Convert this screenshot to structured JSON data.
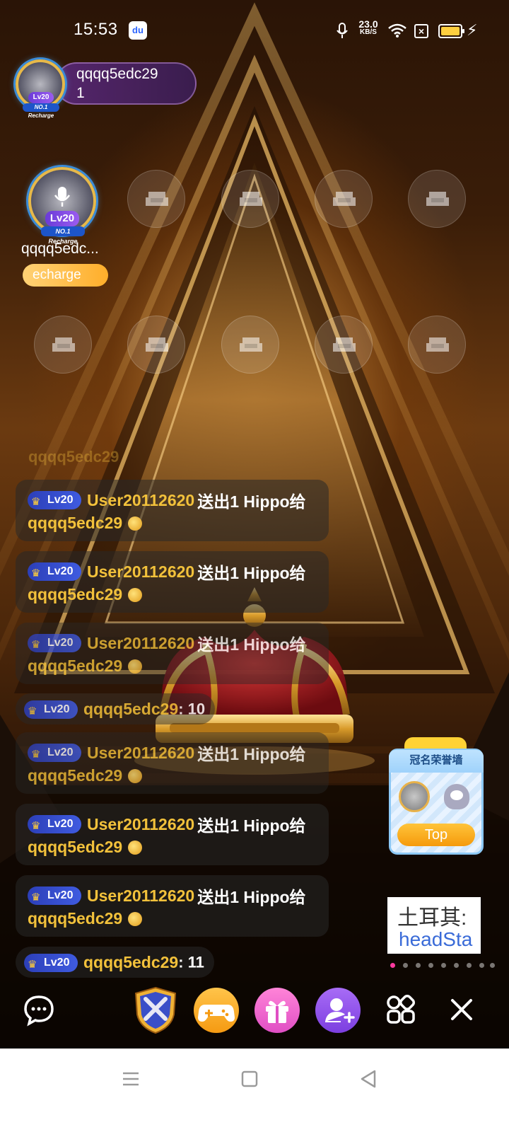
{
  "status_bar": {
    "time": "15:53",
    "net_speed_value": "23.0",
    "net_speed_unit": "KB/S"
  },
  "host": {
    "name": "qqqq5edc29",
    "count": "1",
    "level": "Lv20",
    "badge": "NO.1 Recharge"
  },
  "owner_seat": {
    "name": "qqqq5edc...",
    "level": "Lv20",
    "badge": "NO.1 Recharge",
    "tag": "echarge"
  },
  "chat": {
    "faded_line": "qqqq5edc29",
    "messages": [
      {
        "level": "Lv20",
        "user": "User20112620",
        "action": "送出1 Hippo给",
        "receiver": "qqqq5edc29"
      },
      {
        "level": "Lv20",
        "user": "User20112620",
        "action": "送出1 Hippo给",
        "receiver": "qqqq5edc29"
      },
      {
        "level": "Lv20",
        "user": "User20112620",
        "action": "送出1 Hippo给",
        "receiver": "qqqq5edc29"
      },
      {
        "level": "Lv20",
        "user": "qqqq5edc29",
        "text": ": 10"
      },
      {
        "level": "Lv20",
        "user": "User20112620",
        "action": "送出1 Hippo给",
        "receiver": "qqqq5edc29"
      },
      {
        "level": "Lv20",
        "user": "User20112620",
        "action": "送出1 Hippo给",
        "receiver": "qqqq5edc29"
      },
      {
        "level": "Lv20",
        "user": "User20112620",
        "action": "送出1 Hippo给",
        "receiver": "qqqq5edc29"
      },
      {
        "level": "Lv20",
        "user": "qqqq5edc29",
        "text": ": 11"
      }
    ]
  },
  "honor_wall": {
    "title": "冠名荣誉墙",
    "button": "Top"
  },
  "banner": {
    "line1": "土耳其:",
    "line2": "headSta"
  },
  "colors": {
    "accent_gold": "#f2c13b",
    "level_badge": "#2c3fb8",
    "carousel_active": "#ff3aa0"
  },
  "icons": [
    "chat-bubble-icon",
    "pk-shield-icon",
    "game-controller-icon",
    "gift-icon",
    "add-user-icon",
    "grid-menu-icon",
    "close-icon",
    "sofa-seat-icon",
    "microphone-icon",
    "wifi-icon",
    "battery-icon"
  ]
}
